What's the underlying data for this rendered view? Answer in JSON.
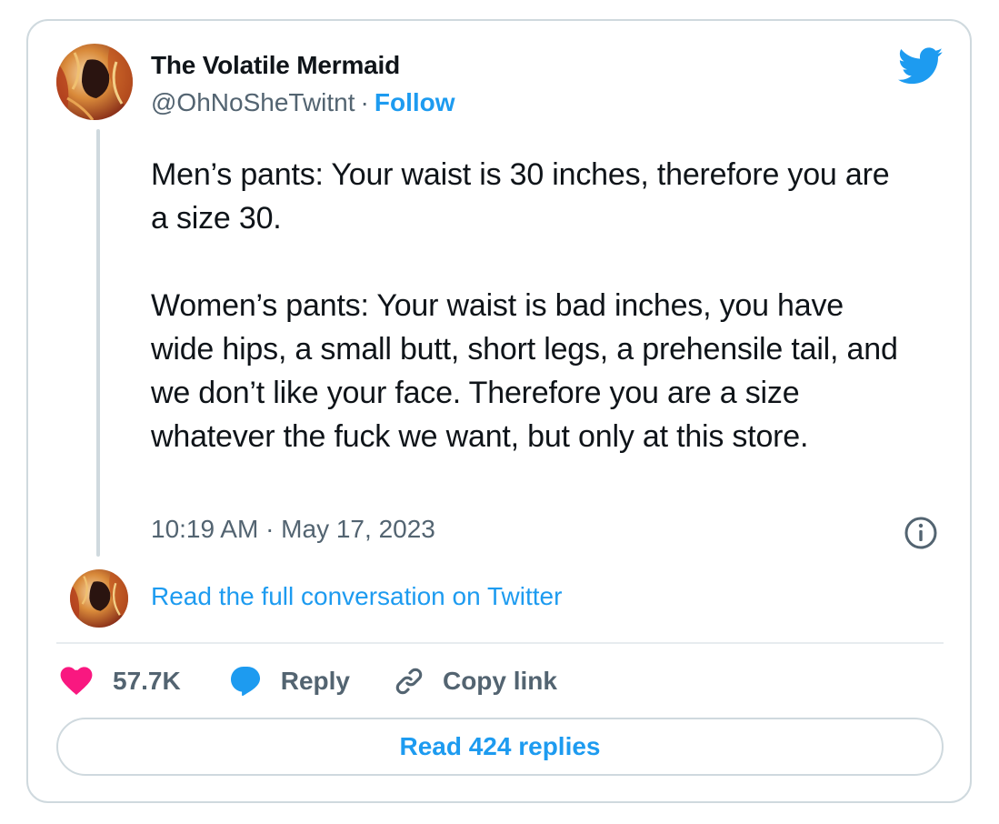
{
  "author": {
    "display_name": "The Volatile Mermaid",
    "handle": "@OhNoSheTwitnt",
    "separator": "·",
    "follow_label": "Follow"
  },
  "tweet": {
    "paragraph_1": "Men’s pants: Your waist is 30 inches, therefore you are a size 30.",
    "paragraph_2": "Women’s pants: Your waist is bad inches, you have wide hips, a small butt, short legs, a prehensile tail, and we don’t like your face. Therefore you are a size whatever the fuck we want, but only at this store.",
    "timestamp": "10:19 AM · May 17, 2023"
  },
  "conversation_link": "Read the full conversation on Twitter",
  "actions": {
    "like_count": "57.7K",
    "reply_label": "Reply",
    "copy_label": "Copy link"
  },
  "replies_button": "Read 424 replies",
  "colors": {
    "accent": "#1d9bf0",
    "like": "#f91880",
    "muted": "#536471",
    "border": "#cfd9de"
  },
  "icons": {
    "brand": "twitter-bird-icon",
    "info": "info-icon",
    "like": "heart-icon",
    "reply": "speech-bubble-icon",
    "copy": "link-icon"
  }
}
